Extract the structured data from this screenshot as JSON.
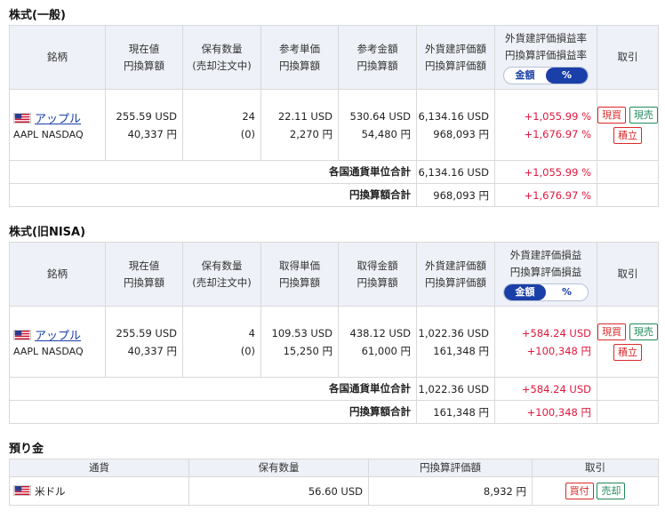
{
  "section1": {
    "title": "株式(一般)",
    "headers": {
      "name": "銘柄",
      "price_l1": "現在値",
      "price_l2": "円換算額",
      "qty_l1": "保有数量",
      "qty_l2": "(売却注文中)",
      "unit_l1": "参考単価",
      "unit_l2": "円換算額",
      "amt_l1": "参考金額",
      "amt_l2": "円換算額",
      "val_l1": "外貨建評価額",
      "val_l2": "円換算評価額",
      "pl_l1": "外貨建評価損益率",
      "pl_l2": "円換算評価損益率",
      "toggle_amount": "金額",
      "toggle_percent": "%",
      "toggle_active": "percent",
      "trade": "取引"
    },
    "row": {
      "name": "アップル",
      "code": "AAPL NASDAQ",
      "price_usd": "255.59 USD",
      "price_jpy": "40,337 円",
      "qty": "24",
      "qty_pending": "(0)",
      "unit_usd": "22.11 USD",
      "unit_jpy": "2,270 円",
      "amt_usd": "530.64 USD",
      "amt_jpy": "54,480 円",
      "val_usd": "6,134.16 USD",
      "val_jpy": "968,093 円",
      "pl_usd": "+1,055.99 %",
      "pl_jpy": "+1,676.97 %",
      "btn_buy": "現買",
      "btn_sell": "現売",
      "btn_accum": "積立"
    },
    "total_currency_label": "各国通貨単位合計",
    "total_currency_val": "6,134.16 USD",
    "total_currency_pl": "+1,055.99 %",
    "total_jpy_label": "円換算額合計",
    "total_jpy_val": "968,093 円",
    "total_jpy_pl": "+1,676.97 %"
  },
  "section2": {
    "title": "株式(旧NISA)",
    "headers": {
      "name": "銘柄",
      "price_l1": "現在値",
      "price_l2": "円換算額",
      "qty_l1": "保有数量",
      "qty_l2": "(売却注文中)",
      "unit_l1": "取得単価",
      "unit_l2": "円換算額",
      "amt_l1": "取得金額",
      "amt_l2": "円換算額",
      "val_l1": "外貨建評価額",
      "val_l2": "円換算評価額",
      "pl_l1": "外貨建評価損益",
      "pl_l2": "円換算評価損益",
      "toggle_amount": "金額",
      "toggle_percent": "%",
      "toggle_active": "amount",
      "trade": "取引"
    },
    "row": {
      "name": "アップル",
      "code": "AAPL NASDAQ",
      "price_usd": "255.59 USD",
      "price_jpy": "40,337 円",
      "qty": "4",
      "qty_pending": "(0)",
      "unit_usd": "109.53 USD",
      "unit_jpy": "15,250 円",
      "amt_usd": "438.12 USD",
      "amt_jpy": "61,000 円",
      "val_usd": "1,022.36 USD",
      "val_jpy": "161,348 円",
      "pl_usd": "+584.24 USD",
      "pl_jpy": "+100,348 円",
      "btn_buy": "現買",
      "btn_sell": "現売",
      "btn_accum": "積立"
    },
    "total_currency_label": "各国通貨単位合計",
    "total_currency_val": "1,022.36 USD",
    "total_currency_pl": "+584.24 USD",
    "total_jpy_label": "円換算額合計",
    "total_jpy_val": "161,348 円",
    "total_jpy_pl": "+100,348 円"
  },
  "deposit": {
    "title": "預り金",
    "headers": {
      "currency": "通貨",
      "qty": "保有数量",
      "jpy": "円換算評価額",
      "trade": "取引"
    },
    "row": {
      "currency": "米ドル",
      "qty": "56.60 USD",
      "jpy": "8,932 円",
      "btn_buy": "買付",
      "btn_sell": "売却"
    }
  },
  "colors": {
    "header_bg": "#eef1f7",
    "accent": "#1a3fa8",
    "positive": "#e0173d",
    "sell": "#1f8a5b"
  },
  "icons": {
    "flag": "us-flag-icon"
  }
}
